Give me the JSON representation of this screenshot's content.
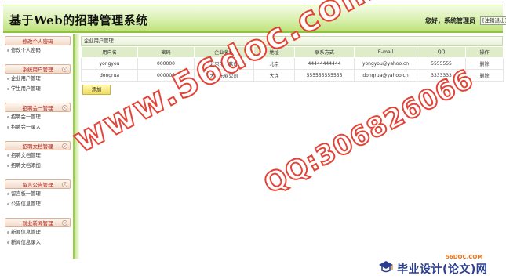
{
  "header": {
    "title": "基于Web的招聘管理系统",
    "greeting": "您好，系统管理员",
    "logout": "[注销退出]"
  },
  "sidebar": {
    "sections": [
      {
        "title": "修改个人密码",
        "items": [
          "修改个人密码"
        ]
      },
      {
        "title": "系统用户管理",
        "items": [
          "企业用户管理",
          "学生用户管理"
        ]
      },
      {
        "title": "招聘会一管理",
        "items": [
          "招聘会一管理",
          "招聘会一录入"
        ]
      },
      {
        "title": "招聘文档管理",
        "items": [
          "招聘文档管理",
          "招聘文档添加"
        ]
      },
      {
        "title": "留言公告管理",
        "items": [
          "留言板一管理",
          "公告信息管理"
        ]
      },
      {
        "title": "就业新闻管理",
        "items": [
          "新闻信息管理",
          "新闻信息录入"
        ]
      }
    ]
  },
  "main": {
    "panel_title": "企业用户管理",
    "columns": [
      "用户名",
      "密码",
      "企业名称",
      "地址",
      "联系方式",
      "E-mail",
      "QQ",
      "操作"
    ],
    "rows": [
      [
        "yongyou",
        "000000",
        "北京用友软件",
        "北京",
        "44444444444",
        "yongyou@yahoo.cn",
        "5555555",
        "删除"
      ],
      [
        "dongrua",
        "000000",
        "大连东软公司",
        "大连",
        "555555555555",
        "dongrua@yahoo.cn",
        "3333333",
        "删除"
      ]
    ],
    "add_button": "添加"
  },
  "watermark": {
    "line1": "www.56doc.com",
    "line2": "QQ:306826066"
  },
  "footer_logo": {
    "url": "56DOC.COM",
    "text": "毕业设计(论文)网"
  },
  "colors": {
    "header_green": "#bfe27a",
    "section_red": "#b0221c",
    "watermark_red": "#e23a2e",
    "logo_blue": "#2a3f8f",
    "add_button_yellow": "#f0dc59"
  }
}
